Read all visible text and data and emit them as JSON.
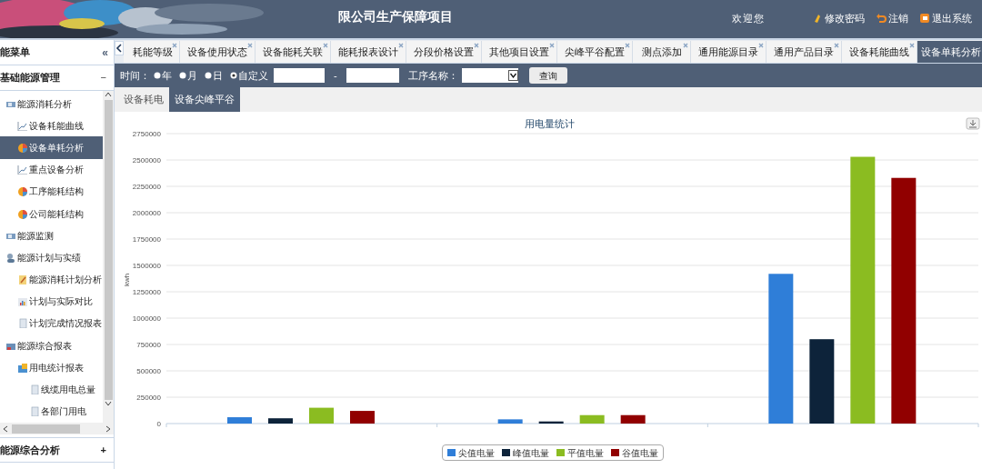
{
  "header": {
    "title": "限公司生产保障项目",
    "welcome": "欢迎您",
    "links": [
      {
        "label": "修改密码"
      },
      {
        "label": "注销"
      },
      {
        "label": "退出系统"
      }
    ]
  },
  "sidebar": {
    "title": "能菜单",
    "collapse": "«",
    "sections": [
      {
        "label": "基础能源管理",
        "expanded": true,
        "toggle": "−",
        "items": [
          {
            "label": "能源消耗分析",
            "kind": "monitor",
            "selected": false,
            "children": [
              {
                "label": "设备耗能曲线",
                "kind": "line",
                "selected": false
              },
              {
                "label": "设备单耗分析",
                "kind": "pie",
                "selected": true
              },
              {
                "label": "重点设备分析",
                "kind": "line",
                "selected": false
              },
              {
                "label": "工序能耗结构",
                "kind": "pie",
                "selected": false
              },
              {
                "label": "公司能耗结构",
                "kind": "pie",
                "selected": false
              }
            ]
          },
          {
            "label": "能源监测",
            "kind": "monitor",
            "selected": false
          },
          {
            "label": "能源计划与实绩",
            "kind": "people",
            "selected": false,
            "children": [
              {
                "label": "能源消耗计划分析",
                "kind": "doc",
                "selected": false
              },
              {
                "label": "计划与实际对比",
                "kind": "bar",
                "selected": false
              },
              {
                "label": "计划完成情况报表",
                "kind": "page",
                "selected": false
              }
            ]
          },
          {
            "label": "能源综合报表",
            "kind": "report",
            "selected": false,
            "children": [
              {
                "label": "用电统计报表",
                "kind": "folder",
                "selected": false,
                "children": [
                  {
                    "label": "线缆用电总量",
                    "kind": "page",
                    "selected": false
                  },
                  {
                    "label": "各部门用电",
                    "kind": "page",
                    "selected": false
                  }
                ]
              }
            ]
          }
        ]
      },
      {
        "label": "能源综合分析",
        "expanded": false,
        "toggle": "+"
      }
    ]
  },
  "tabs": [
    {
      "label": "耗能等级",
      "selected": false
    },
    {
      "label": "设备使用状态",
      "selected": false
    },
    {
      "label": "设备能耗关联",
      "selected": false
    },
    {
      "label": "能耗报表设计",
      "selected": false
    },
    {
      "label": "分段价格设置",
      "selected": false
    },
    {
      "label": "其他项目设置",
      "selected": false
    },
    {
      "label": "尖峰平谷配置",
      "selected": false
    },
    {
      "label": "测点添加",
      "selected": false
    },
    {
      "label": "通用能源目录",
      "selected": false
    },
    {
      "label": "通用产品目录",
      "selected": false
    },
    {
      "label": "设备耗能曲线",
      "selected": false
    },
    {
      "label": "设备单耗分析",
      "selected": true
    }
  ],
  "filter": {
    "time_label": "时间：",
    "periods": [
      {
        "label": "年",
        "selected": false
      },
      {
        "label": "月",
        "selected": false
      },
      {
        "label": "日",
        "selected": false
      },
      {
        "label": "自定义",
        "selected": true
      }
    ],
    "separator": "-",
    "process_label": "工序名称：",
    "query_button": "查询"
  },
  "subtabs": [
    {
      "label": "设备耗电",
      "selected": false
    },
    {
      "label": "设备尖峰平谷",
      "selected": true
    }
  ],
  "chart": {
    "chart_data": {
      "type": "bar",
      "grid": true,
      "legend": "bottom",
      "title": "用电量统计",
      "ylabel": "kwh",
      "ylim": [
        0,
        2750000
      ],
      "yticks": [
        0,
        250000,
        500000,
        750000,
        1000000,
        1250000,
        1500000,
        1750000,
        2000000,
        2250000,
        2500000,
        2750000
      ],
      "series": [
        {
          "name": "尖值电量",
          "color": "#2f7ed8",
          "values": [
            60000,
            40000,
            1420000
          ]
        },
        {
          "name": "峰值电量",
          "color": "#0d233a",
          "values": [
            50000,
            20000,
            800000
          ]
        },
        {
          "name": "平值电量",
          "color": "#8bbc21",
          "values": [
            150000,
            80000,
            2530000
          ]
        },
        {
          "name": "谷值电量",
          "color": "#910000",
          "values": [
            120000,
            80000,
            2330000
          ]
        }
      ]
    }
  }
}
